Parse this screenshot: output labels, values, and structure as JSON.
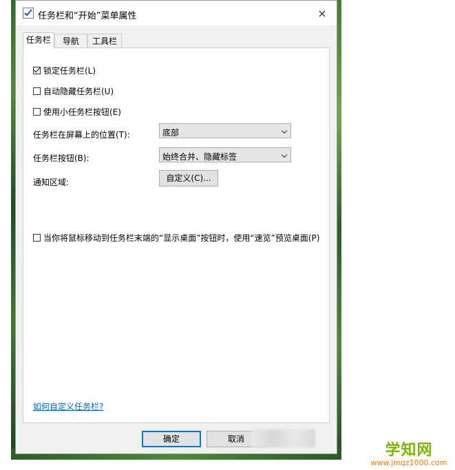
{
  "window": {
    "title": "任务栏和“开始”菜单属性",
    "close_icon": "×"
  },
  "tabs": [
    {
      "label": "任务栏",
      "active": true
    },
    {
      "label": "导航",
      "active": false
    },
    {
      "label": "工具栏",
      "active": false
    }
  ],
  "options": {
    "lock_taskbar": {
      "label": "锁定任务栏(L)",
      "checked": true
    },
    "auto_hide": {
      "label": "自动隐藏任务栏(U)",
      "checked": false
    },
    "small_buttons": {
      "label": "使用小任务栏按钮(E)",
      "checked": false
    },
    "peek": {
      "label": "当你将鼠标移动到任务栏末端的“显示桌面”按钮时，使用“速览”预览桌面(P)",
      "checked": false
    }
  },
  "position": {
    "label": "任务栏在屏幕上的位置(T):",
    "value": "底部"
  },
  "buttons_setting": {
    "label": "任务栏按钮(B):",
    "value": "始终合并、隐藏标签"
  },
  "notification": {
    "label": "通知区域:",
    "button": "自定义(C)..."
  },
  "help_link": "如何自定义任务栏?",
  "footer": {
    "ok": "确定",
    "cancel": "取消"
  },
  "watermark": {
    "main": "学知网",
    "sub": "www.jmqz1000.com"
  },
  "colors": {
    "link": "#0066cc",
    "default_button_border": "#0078d7",
    "watermark_green": "#7ab800",
    "watermark_orange": "#ff7a00"
  }
}
